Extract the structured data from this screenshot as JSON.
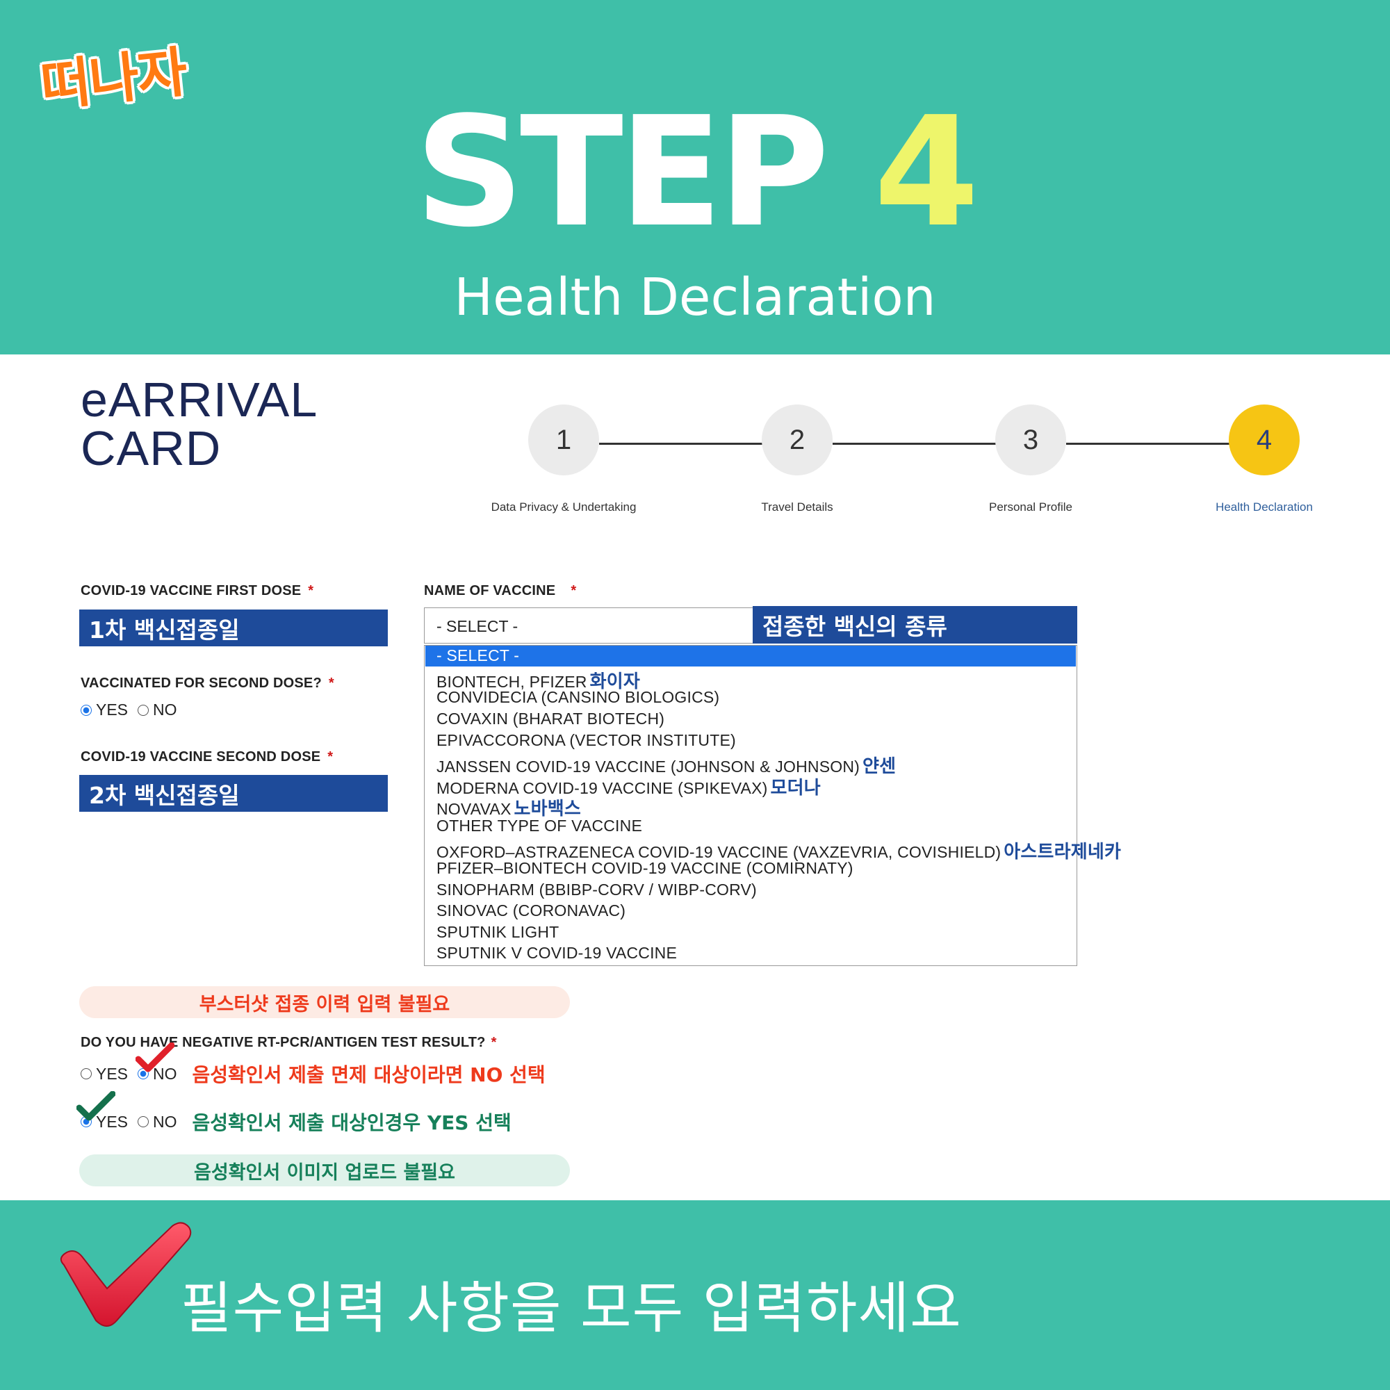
{
  "brand_logo": "떠나자",
  "header": {
    "step_word": "STEP",
    "step_number": "4",
    "subtitle": "Health Declaration"
  },
  "card": {
    "title_line1": "eARRIVAL",
    "title_line2": "CARD"
  },
  "stepper": [
    {
      "number": "1",
      "label": "Data Privacy & Undertaking",
      "active": false
    },
    {
      "number": "2",
      "label": "Travel Details",
      "active": false
    },
    {
      "number": "3",
      "label": "Personal Profile",
      "active": false
    },
    {
      "number": "4",
      "label": "Health Declaration",
      "active": true
    }
  ],
  "form": {
    "first_dose_label": "COVID-19 VACCINE FIRST DOSE",
    "first_dose_overlay": "1차 백신접종일",
    "second_dose_question": "VACCINATED FOR SECOND DOSE?",
    "yes": "YES",
    "no": "NO",
    "second_dose_label": "COVID-19 VACCINE SECOND DOSE",
    "second_dose_overlay": "2차 백신접종일",
    "vaccine_label": "NAME OF VACCINE",
    "vaccine_select_value": "- SELECT -",
    "vaccine_overlay": "접종한 백신의 종류",
    "required_mark": "*",
    "booster_note": "부스터샷 접종 이력 입력 불필요",
    "test_question": "DO YOU HAVE NEGATIVE RT-PCR/ANTIGEN TEST RESULT?",
    "test_no_note": "음성확인서 제출 면제 대상이라면 NO 선택",
    "test_yes_note": "음성확인서 제출 대상인경우 YES 선택",
    "upload_note": "음성확인서 이미지 업로드 불필요"
  },
  "vaccine_options": [
    {
      "label": "- SELECT -",
      "ko": ""
    },
    {
      "label": "BIONTECH, PFIZER",
      "ko": "화이자"
    },
    {
      "label": "CONVIDECIA (CANSINO BIOLOGICS)",
      "ko": ""
    },
    {
      "label": "COVAXIN (BHARAT BIOTECH)",
      "ko": ""
    },
    {
      "label": "EPIVACCORONA (VECTOR INSTITUTE)",
      "ko": ""
    },
    {
      "label": "JANSSEN COVID-19 VACCINE (JOHNSON & JOHNSON)",
      "ko": "얀센"
    },
    {
      "label": "MODERNA COVID-19 VACCINE (SPIKEVAX)",
      "ko": "모더나"
    },
    {
      "label": "NOVAVAX",
      "ko": "노바백스"
    },
    {
      "label": "OTHER TYPE OF VACCINE",
      "ko": ""
    },
    {
      "label": "OXFORD–ASTRAZENECA COVID-19 VACCINE (VAXZEVRIA, COVISHIELD)",
      "ko": "아스트라제네카"
    },
    {
      "label": "PFIZER–BIONTECH COVID-19 VACCINE (COMIRNATY)",
      "ko": ""
    },
    {
      "label": "SINOPHARM (BBIBP-CORV / WIBP-CORV)",
      "ko": ""
    },
    {
      "label": "SINOVAC (CORONAVAC)",
      "ko": ""
    },
    {
      "label": "SPUTNIK LIGHT",
      "ko": ""
    },
    {
      "label": "SPUTNIK V COVID-19 VACCINE",
      "ko": ""
    }
  ],
  "footer": {
    "instruction": "필수입력 사항을 모두 입력하세요"
  },
  "colors": {
    "teal": "#3fbfa8",
    "step_yellow": "#eef56b",
    "navy": "#1b2755",
    "overlay_blue": "#1e4b9a",
    "active_step": "#f6c514",
    "red_note": "#ee3a1c",
    "green_note": "#16805a"
  }
}
